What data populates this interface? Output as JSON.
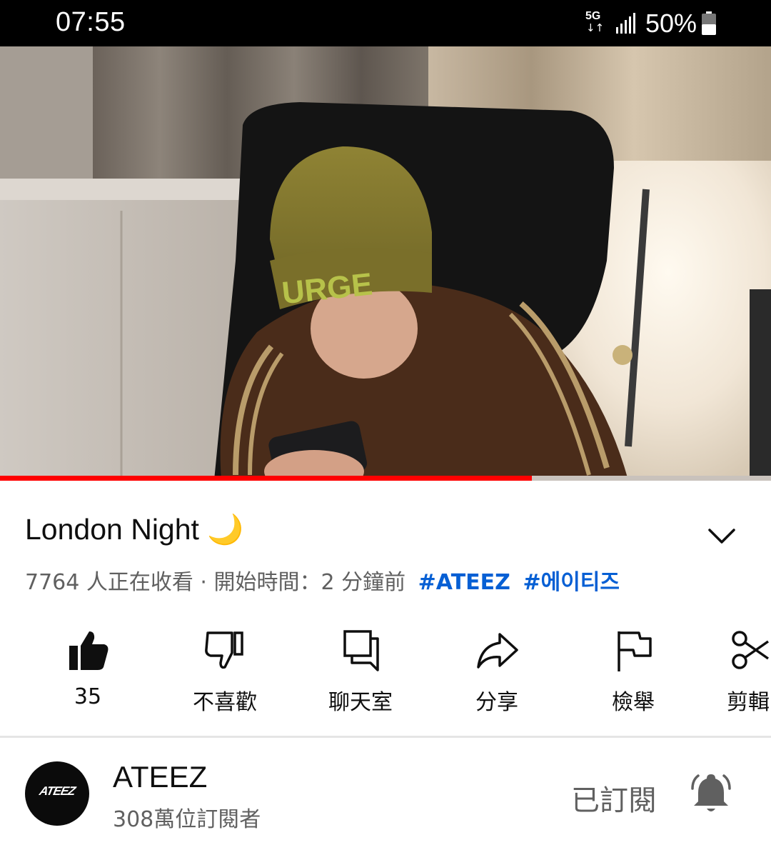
{
  "status_bar": {
    "time": "07:55",
    "network": "5G",
    "network_arrows": "↓↑",
    "battery_text": "50%",
    "battery_level": 0.5,
    "icons": [
      "network-5g-icon",
      "signal-icon",
      "battery-icon"
    ]
  },
  "video": {
    "progress": 0.69,
    "accent_color": "#ff0000"
  },
  "title": {
    "text": "London Night 🌙"
  },
  "meta": {
    "viewers": "7764 人正在收看 · 開始時間：2 分鐘前",
    "hashtags": [
      "#ATEEZ",
      "#에이티즈"
    ]
  },
  "actions": [
    {
      "name": "like",
      "icon": "thumbs-up-icon",
      "label": "35"
    },
    {
      "name": "dislike",
      "icon": "thumbs-down-icon",
      "label": "不喜歡"
    },
    {
      "name": "chat",
      "icon": "chat-icon",
      "label": "聊天室"
    },
    {
      "name": "share",
      "icon": "share-icon",
      "label": "分享"
    },
    {
      "name": "report",
      "icon": "flag-icon",
      "label": "檢舉"
    },
    {
      "name": "clip",
      "icon": "scissors-icon",
      "label": "剪輯"
    }
  ],
  "channel": {
    "avatar_logo": "ATEEZ",
    "name": "ATEEZ",
    "subscribers": "308萬位訂閱者",
    "subscribed_label": "已訂閱",
    "bell_icon": "bell-icon"
  },
  "colors": {
    "link": "#065fd4",
    "secondary_text": "#606060",
    "primary_text": "#0f0f0f"
  }
}
